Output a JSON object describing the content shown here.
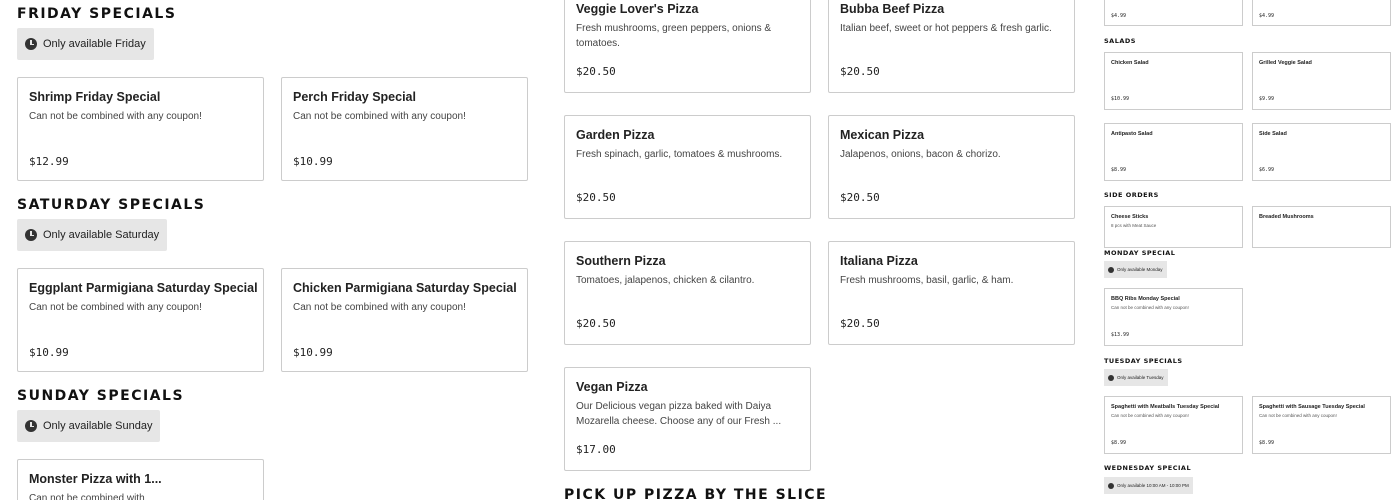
{
  "left": {
    "friday": {
      "title": "FRIDAY SPECIALS",
      "availability": "Only available Friday",
      "items": [
        {
          "name": "Shrimp Friday Special",
          "desc": "Can not be combined with any coupon!",
          "price": "$12.99"
        },
        {
          "name": "Perch Friday Special",
          "desc": "Can not be combined with any coupon!",
          "price": "$10.99"
        }
      ]
    },
    "saturday": {
      "title": "SATURDAY SPECIALS",
      "availability": "Only available Saturday",
      "items": [
        {
          "name": "Eggplant Parmigiana Saturday Special",
          "desc": "Can not be combined with any coupon!",
          "price": "$10.99"
        },
        {
          "name": "Chicken Parmigiana Saturday Special",
          "desc": "Can not be combined with any coupon!",
          "price": "$10.99"
        }
      ]
    },
    "sunday": {
      "title": "SUNDAY SPECIALS",
      "availability": "Only available Sunday",
      "items": [
        {
          "name": "Monster Pizza with 1...",
          "desc": "Can not be combined with"
        }
      ]
    }
  },
  "middle": {
    "items": [
      {
        "name": "Veggie Lover's Pizza",
        "desc": "Fresh mushrooms, green peppers, onions & tomatoes.",
        "price": "$20.50"
      },
      {
        "name": "Bubba Beef Pizza",
        "desc": "Italian beef, sweet or hot peppers & fresh garlic.",
        "price": "$20.50"
      },
      {
        "name": "Garden Pizza",
        "desc": "Fresh spinach, garlic, tomatoes & mushrooms.",
        "price": "$20.50"
      },
      {
        "name": "Mexican Pizza",
        "desc": "Jalapenos, onions, bacon & chorizo.",
        "price": "$20.50"
      },
      {
        "name": "Southern Pizza",
        "desc": "Tomatoes, jalapenos, chicken & cilantro.",
        "price": "$20.50"
      },
      {
        "name": "Italiana Pizza",
        "desc": "Fresh mushrooms, basil, garlic, & ham.",
        "price": "$20.50"
      },
      {
        "name": "Vegan Pizza",
        "desc": "Our Delicious vegan pizza baked with Daiya Mozarella cheese. Choose any of our Fresh ...",
        "price": "$17.00"
      }
    ],
    "slice_title": "PICK UP PIZZA BY THE SLICE"
  },
  "right": {
    "top_prices": [
      "$4.99",
      "$4.99"
    ],
    "salads": {
      "title": "SALADS",
      "items": [
        {
          "name": "Chicken Salad",
          "price": "$10.99"
        },
        {
          "name": "Grilled Veggie Salad",
          "price": "$9.99"
        },
        {
          "name": "Antipasto Salad",
          "price": "$8.99"
        },
        {
          "name": "Side Salad",
          "price": "$6.99"
        }
      ]
    },
    "side_orders": {
      "title": "SIDE ORDERS",
      "items": [
        {
          "name": "Cheese Sticks",
          "desc": "8 pcs with Meat Sauce"
        },
        {
          "name": "Breaded Mushrooms"
        }
      ]
    },
    "monday": {
      "title": "MONDAY SPECIAL",
      "availability": "Only available Monday",
      "items": [
        {
          "name": "BBQ Ribs Monday Special",
          "desc": "Can not be combined with any coupon!",
          "price": "$13.99"
        }
      ]
    },
    "tuesday": {
      "title": "TUESDAY SPECIALS",
      "availability": "Only available Tuesday",
      "items": [
        {
          "name": "Spaghetti with Meatballs Tuesday Special",
          "desc": "Can not be combined with any coupon!",
          "price": "$8.99"
        },
        {
          "name": "Spaghetti with Sausage Tuesday Special",
          "desc": "Can not be combined with any coupon!",
          "price": "$8.99"
        }
      ]
    },
    "wednesday": {
      "title": "WEDNESDAY SPECIAL",
      "availability": "Only available 10:00 AM - 10:00 PM"
    }
  }
}
